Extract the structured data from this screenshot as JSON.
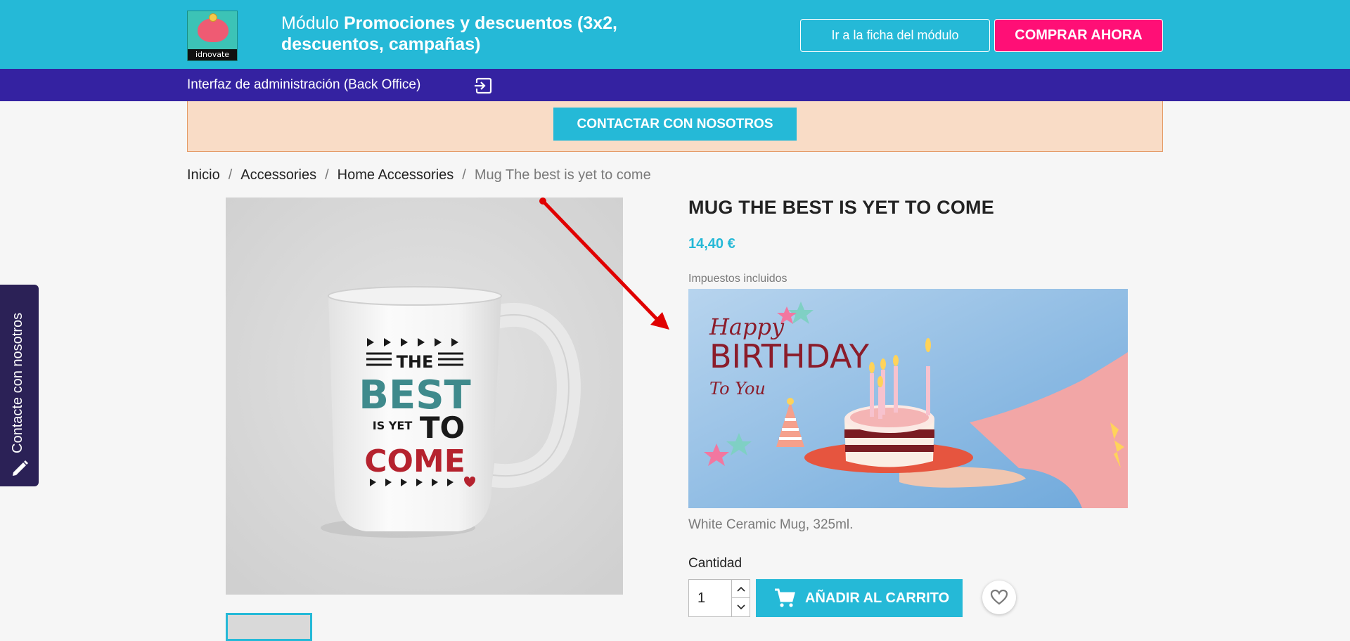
{
  "header": {
    "logo_text": "idnovate",
    "module_prefix": "Módulo ",
    "module_name": "Promociones y descuentos (3x2, descuentos, campañas)",
    "ficha_button": "Ir a la ficha del módulo",
    "buy_button": "COMPRAR AHORA"
  },
  "adminbar": {
    "label": "Interfaz de administración (Back Office)"
  },
  "contact": {
    "button": "CONTACTAR CON NOSOTROS"
  },
  "side_tab": {
    "label": "Contacte con nosotros"
  },
  "breadcrumb": {
    "items": [
      "Inicio",
      "Accessories",
      "Home Accessories"
    ],
    "current": "Mug The best is yet to come"
  },
  "product": {
    "name": "MUG THE BEST IS YET TO COME",
    "price": "14,40 €",
    "tax_note": "Impuestos incluidos",
    "description": "White Ceramic Mug, 325ml.",
    "quantity_label": "Cantidad",
    "quantity_value": "1",
    "add_to_cart": "AÑADIR AL CARRITO",
    "mug_text": {
      "line1": "THE",
      "line2": "BEST",
      "line3a": "IS YET",
      "line3b": "TO",
      "line4": "COME"
    }
  },
  "promo_banner": {
    "line1": "Happy",
    "line2": "BIRTHDAY",
    "line3": "To You"
  },
  "colors": {
    "primary": "#25b9d7",
    "buy": "#ff0f76",
    "admin_bar": "#3422a1",
    "strip": "#f9dcc6",
    "arrow": "#e00000"
  },
  "icons": {
    "admin": "exit-arrow-icon",
    "side": "pencil-icon",
    "cart": "cart-icon",
    "wishlist": "heart-icon",
    "qty_up": "chevron-up-icon",
    "qty_down": "chevron-down-icon"
  }
}
